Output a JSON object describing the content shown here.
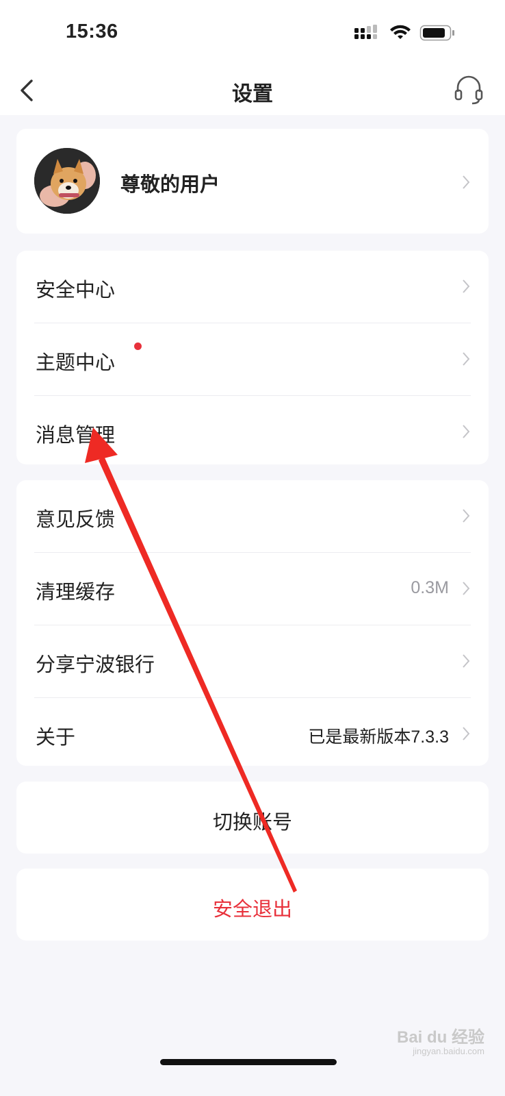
{
  "status_bar": {
    "time": "15:36"
  },
  "header": {
    "title": "设置"
  },
  "profile": {
    "name": "尊敬的用户"
  },
  "group1": [
    {
      "label": "安全中心"
    },
    {
      "label": "主题中心",
      "badge": "red-dot"
    },
    {
      "label": "消息管理"
    }
  ],
  "group2": [
    {
      "label": "意见反馈",
      "value": ""
    },
    {
      "label": "清理缓存",
      "value": "0.3M"
    },
    {
      "label": "分享宁波银行",
      "value": ""
    },
    {
      "label": "关于",
      "value": "已是最新版本7.3.3"
    }
  ],
  "switch_account": {
    "label": "切换账号"
  },
  "logout": {
    "label": "安全退出"
  },
  "watermark": {
    "brand": "Bai du 经验",
    "url": "jingyan.baidu.com"
  },
  "colors": {
    "accent_red": "#e8313b",
    "value_grey": "#9a9aa0",
    "value_dark": "#222222"
  },
  "icons": [
    "back-chevron-icon",
    "headset-icon",
    "signal-icon",
    "wifi-icon",
    "battery-icon",
    "chevron-right-icon"
  ]
}
